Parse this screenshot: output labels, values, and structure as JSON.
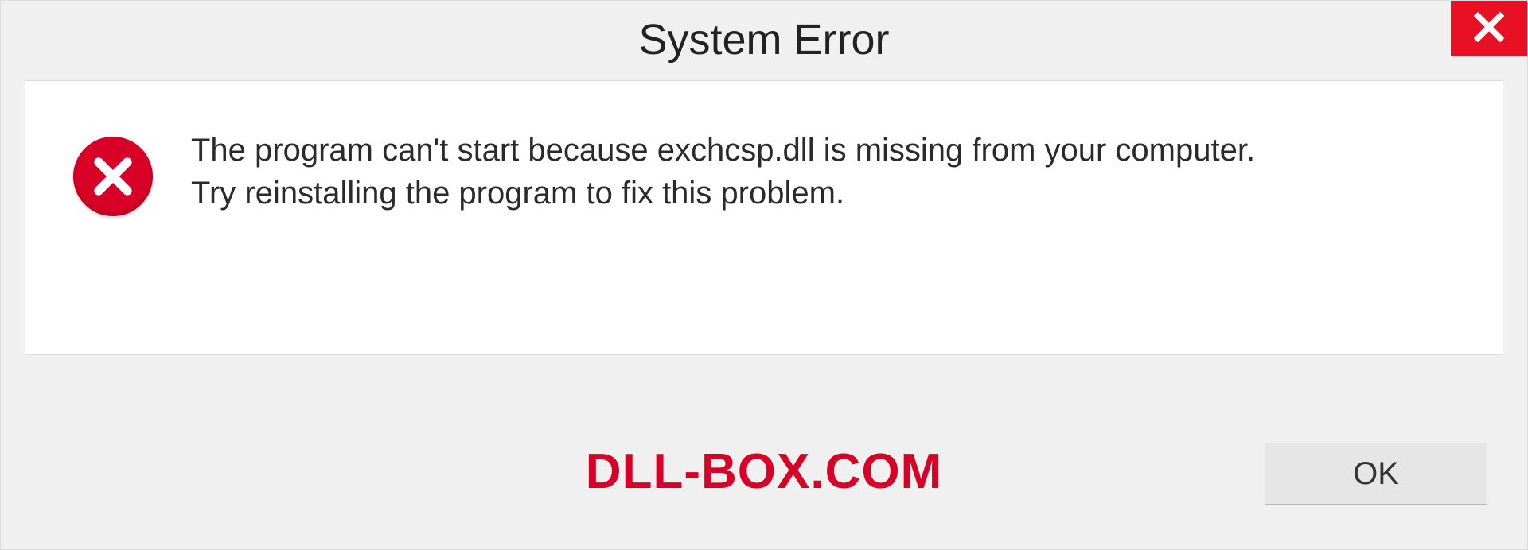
{
  "dialog": {
    "title": "System Error",
    "message_line1": "The program can't start because exchcsp.dll is missing from your computer.",
    "message_line2": "Try reinstalling the program to fix this problem.",
    "ok_label": "OK"
  },
  "watermark": "DLL-BOX.COM",
  "colors": {
    "close_bg": "#e81123",
    "error_bg": "#d80027",
    "watermark_color": "#d80027"
  }
}
